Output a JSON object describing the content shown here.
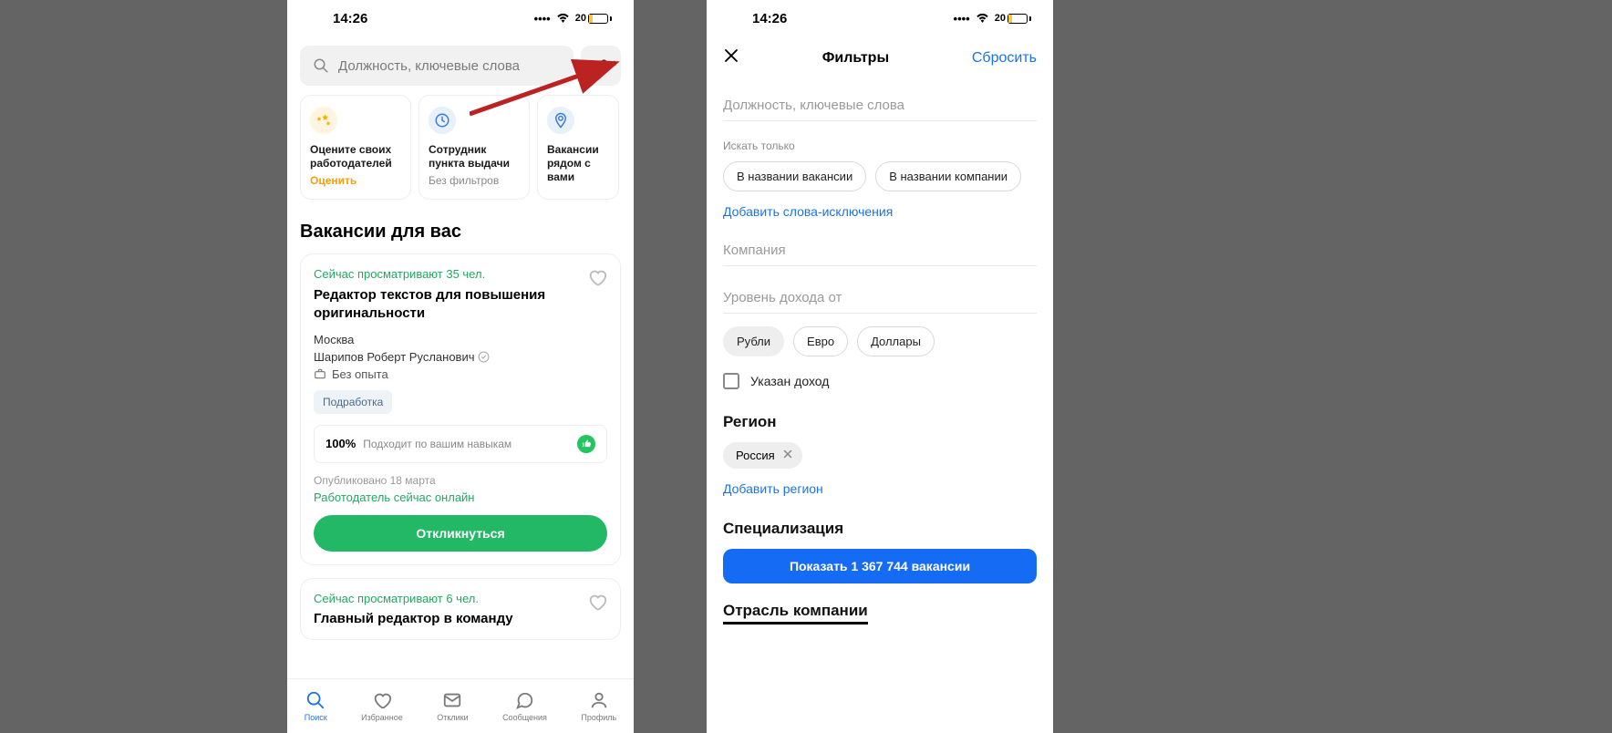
{
  "status": {
    "time": "14:26",
    "battery_pct": "20"
  },
  "phone1": {
    "search_placeholder": "Должность, ключевые слова",
    "cards": {
      "rate": {
        "title": "Оцените своих работодателей",
        "sub": "Оценить"
      },
      "pickup": {
        "title": "Сотрудник пункта выдачи",
        "sub": "Без фильтров"
      },
      "near": {
        "title": "Вакансии рядом с вами"
      }
    },
    "section_title": "Вакансии для вас",
    "vacancy": {
      "watching": "Сейчас просматривают 35 чел.",
      "title": "Редактор текстов для повышения оригинальности",
      "city": "Москва",
      "employer": "Шарипов Роберт Русланович",
      "experience": "Без опыта",
      "tag": "Подработка",
      "skills_pct": "100%",
      "skills_text": "Подходит по вашим навыкам",
      "published": "Опубликовано 18 марта",
      "online": "Работодатель сейчас онлайн",
      "apply": "Откликнуться"
    },
    "vacancy2": {
      "watching": "Сейчас просматривают 6 чел.",
      "title": "Главный редактор в команду"
    },
    "tabs": {
      "search": "Поиск",
      "fav": "Избранное",
      "resp": "Отклики",
      "msg": "Сообщения",
      "profile": "Профиль"
    }
  },
  "phone2": {
    "header": {
      "title": "Фильтры",
      "reset": "Сбросить"
    },
    "position_placeholder": "Должность, ключевые слова",
    "search_only_label": "Искать только",
    "search_only_options": {
      "in_title": "В названии вакансии",
      "in_company": "В названии компании"
    },
    "add_exclusions": "Добавить слова-исключения",
    "company_label": "Компания",
    "income_label": "Уровень дохода от",
    "currencies": {
      "rub": "Рубли",
      "eur": "Евро",
      "usd": "Доллары"
    },
    "income_specified": "Указан доход",
    "region_h": "Регион",
    "region_value": "Россия",
    "add_region": "Добавить регион",
    "spec_h": "Специализация",
    "show_btn": "Показать 1 367 744 вакансии",
    "industry_h": "Отрасль компании"
  }
}
